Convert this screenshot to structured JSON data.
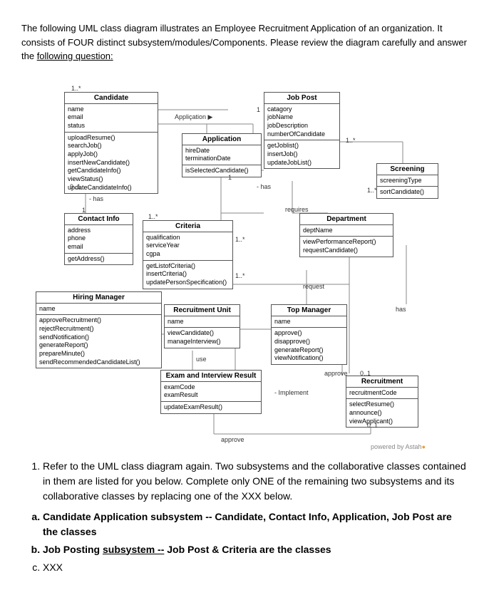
{
  "intro": {
    "prefix": "The following UML class diagram illustrates an Employee Recruitment Application of an organization. It consists of FOUR distinct subsystem/modules/Components. Please review the diagram carefully and answer the ",
    "underline": "following question:"
  },
  "classes": {
    "candidate": {
      "name": "Candidate",
      "attrs": "name\nemail\nstatus",
      "ops": "uploadResume()\nsearchJob()\napplyJob()\ninsertNewCandidate()\ngetCandidateInfo()\nviewStatus()\nupdateCandidateInfo()"
    },
    "application": {
      "name": "Application",
      "attrs": "hireDate\nterminationDate",
      "ops": "isSelectedCandidate()"
    },
    "jobpost": {
      "name": "Job Post",
      "attrs": "catagory\njobName\njobDescription\nnumberOfCandidate",
      "ops": "getJoblist()\ninsertJob()\nupdateJobList()"
    },
    "screening": {
      "name": "Screening",
      "attrs": "screeningType",
      "ops": "sortCandidate()"
    },
    "contact": {
      "name": "Contact Info",
      "attrs": "address\nphone\nemail",
      "ops": "getAddress()"
    },
    "criteria": {
      "name": "Criteria",
      "attrs": "qualification\nserviceYear\ncgpa",
      "ops": "getListofCriteria()\ninsertCriteria()\nupdatePersonSpecification()"
    },
    "department": {
      "name": "Department",
      "attrs": "deptName",
      "ops": "viewPerformanceReport()\nrequestCandidate()"
    },
    "hiring": {
      "name": "Hiring Manager",
      "attrs": "name",
      "ops": "approveRecruitment()\nrejectRecruitment()\nsendNotification()\ngenerateReport()\nprepareMinute()\nsendRecommendedCandidateList()"
    },
    "recunit": {
      "name": "Recruitment Unit",
      "attrs": "name",
      "ops": "viewCandidate()\nmanageInterview()"
    },
    "topmgr": {
      "name": "Top Manager",
      "attrs": "name",
      "ops": "approve()\ndisapprove()\ngenerateReport()\nviewNotification()"
    },
    "exam": {
      "name": "Exam and Interview Result",
      "attrs": "examCode\nexamResult",
      "ops": "updateExamResult()"
    },
    "recruitment": {
      "name": "Recruitment",
      "attrs": "recruitmentCode",
      "ops": "selectResume()\nannounce()\nviewApplicant()"
    }
  },
  "labels": {
    "applbl": "Appliçation ▶",
    "has1": "- has",
    "has2": "- has",
    "has3": "has",
    "requires": "requires",
    "request": "request",
    "use": "use",
    "approve_top": "approve",
    "approve_bot": "approve",
    "implement": "- Implement",
    "m01": "0..1",
    "m1a": "1",
    "m1b": "1",
    "m1c": "1",
    "m1d": "1",
    "m1e": "1",
    "m1star1": "1..*",
    "m1star2": "1..*",
    "m1star3": "1..*",
    "m1star4": "1..*",
    "m1star5": "1..*",
    "m1star6": "1..*",
    "m01b": "0..1",
    "m01c": "0..1",
    "footer": "powered by Astah"
  },
  "question": {
    "lead": "Refer to the UML class diagram again. Two subsystems and the collaborative classes contained in them are listed for you below. Complete only ONE of the remaining two subsystems and its collaborative classes by replacing one of the XXX below.",
    "a_pre": "Candidate Application subsystem -- Candidate, Contact Info, Application, Job Post are the classes",
    "b_pre": "Job Posting ",
    "b_u": "subsystem --",
    "b_post": " Job Post & Criteria are the classes",
    "c": "XXX"
  }
}
